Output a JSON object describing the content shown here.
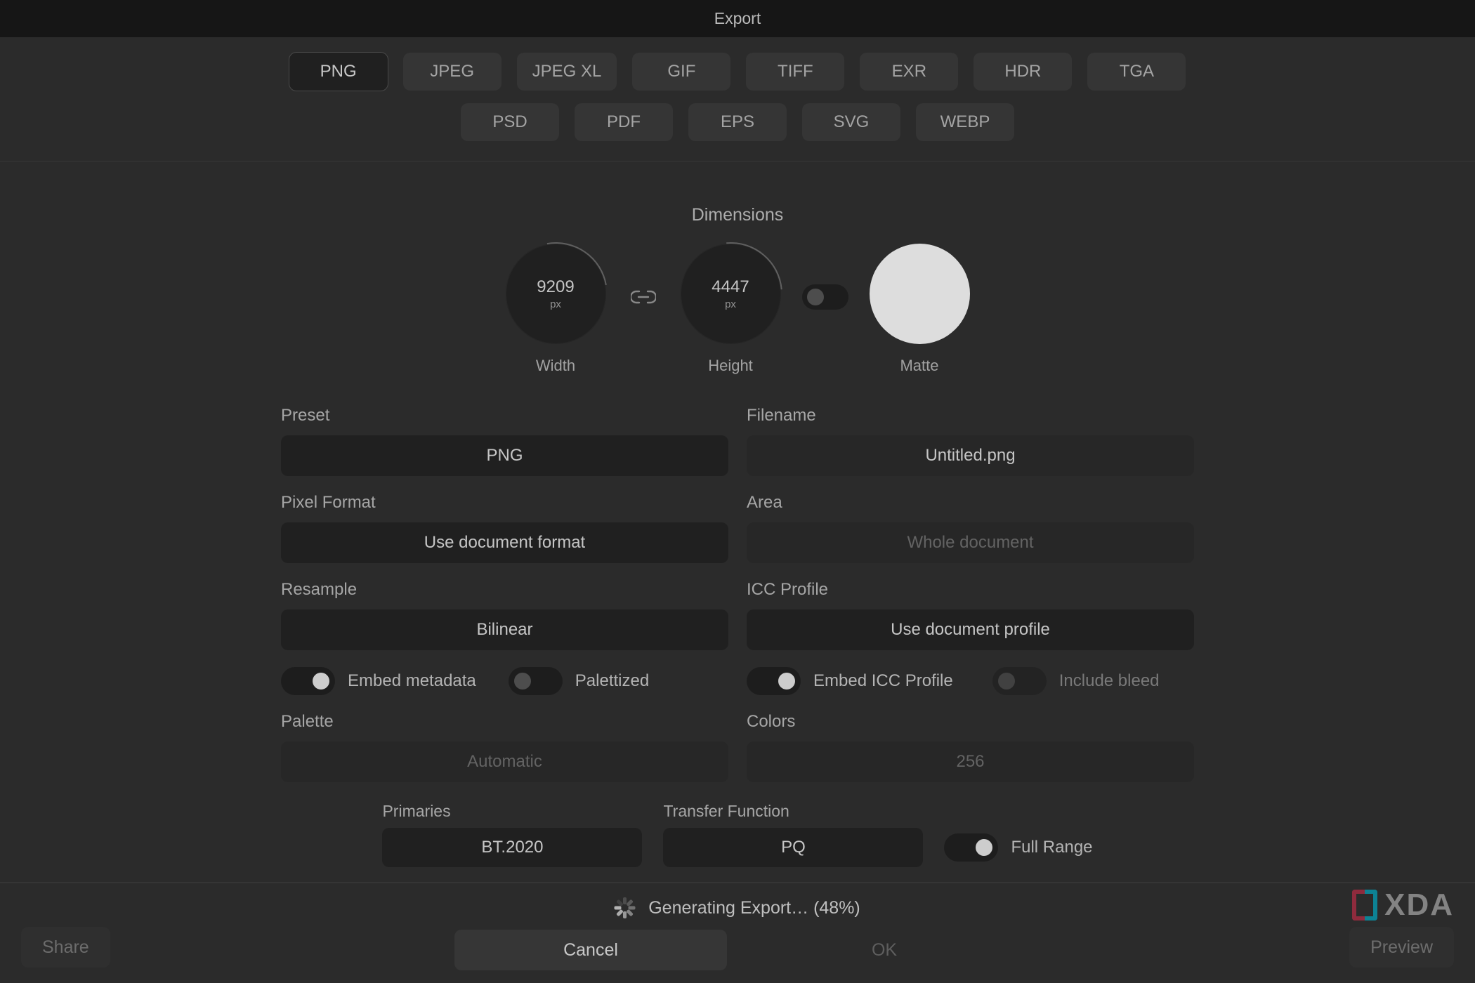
{
  "header": {
    "title": "Export"
  },
  "format_tabs": {
    "row1": [
      "PNG",
      "JPEG",
      "JPEG XL",
      "GIF",
      "TIFF",
      "EXR",
      "HDR",
      "TGA"
    ],
    "row2": [
      "PSD",
      "PDF",
      "EPS",
      "SVG",
      "WEBP"
    ],
    "selected": "PNG"
  },
  "dimensions": {
    "section_label": "Dimensions",
    "width_value": "9209",
    "height_value": "4447",
    "unit": "px",
    "width_label": "Width",
    "height_label": "Height",
    "matte_label": "Matte",
    "matte_color": "#ffffff",
    "matte_toggle_on": false
  },
  "fields": {
    "preset": {
      "label": "Preset",
      "value": "PNG"
    },
    "filename": {
      "label": "Filename",
      "value": "Untitled.png"
    },
    "pixel_format": {
      "label": "Pixel Format",
      "value": "Use document format"
    },
    "area": {
      "label": "Area",
      "value": "Whole document"
    },
    "resample": {
      "label": "Resample",
      "value": "Bilinear"
    },
    "icc_profile": {
      "label": "ICC Profile",
      "value": "Use document profile"
    },
    "palette": {
      "label": "Palette",
      "value": "Automatic"
    },
    "colors": {
      "label": "Colors",
      "value": "256"
    },
    "primaries": {
      "label": "Primaries",
      "value": "BT.2020"
    },
    "transfer_fn": {
      "label": "Transfer Function",
      "value": "PQ"
    }
  },
  "toggles": {
    "embed_metadata": {
      "label": "Embed metadata",
      "on": true
    },
    "palettized": {
      "label": "Palettized",
      "on": false
    },
    "embed_icc": {
      "label": "Embed ICC Profile",
      "on": true
    },
    "include_bleed": {
      "label": "Include bleed",
      "on": false,
      "disabled": true
    },
    "full_range": {
      "label": "Full Range",
      "on": true
    }
  },
  "footer": {
    "progress_text": "Generating Export… (48%)",
    "cancel": "Cancel",
    "ok": "OK",
    "share": "Share",
    "preview": "Preview"
  },
  "watermark": {
    "text": "XDA"
  }
}
